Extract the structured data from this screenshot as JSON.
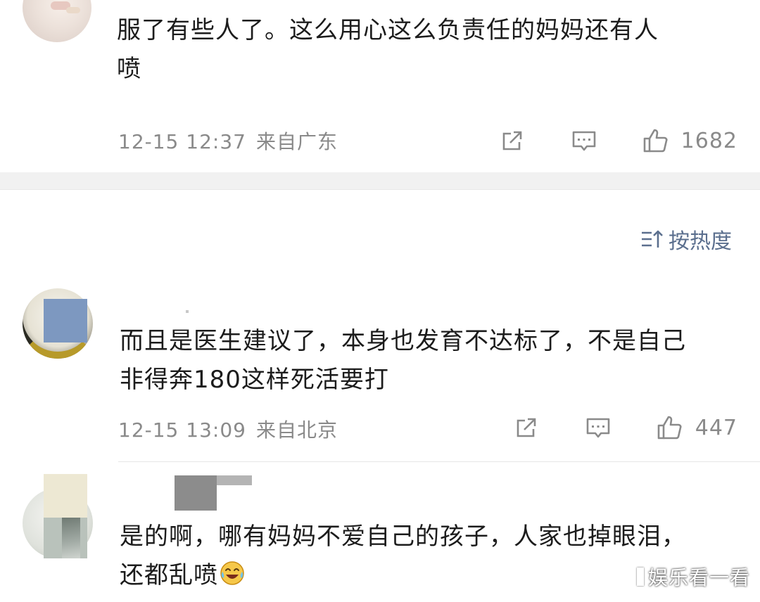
{
  "comments": [
    {
      "text_line1": "服了有些人了。这么用心这么负责任的妈妈还有人",
      "text_line2": "喷",
      "date": "12-15 12:37",
      "location": "来自广东",
      "likes": "1682",
      "share_icon": "share-icon",
      "reply_icon": "comment-icon",
      "like_icon": "like-icon"
    },
    {
      "text_line1": "而且是医生建议了，本身也发育不达标了，不是自己",
      "text_line2": "非得奔180这样死活要打",
      "date": "12-15 13:09",
      "location": "来自北京",
      "likes": "447",
      "share_icon": "share-icon",
      "reply_icon": "comment-icon",
      "like_icon": "like-icon"
    },
    {
      "text_line1": "是的啊，哪有妈妈不爱自己的孩子，人家也掉眼泪，",
      "text_line2": "还都乱喷",
      "emoji": "laughing-crying-emoji"
    }
  ],
  "sort": {
    "label": "按热度",
    "icon": "sort-icon"
  },
  "watermark": "娱乐看一看",
  "colors": {
    "meta_text": "#8a8a8a",
    "sort_link": "#5b6f8e",
    "band": "#f1f1f1"
  }
}
